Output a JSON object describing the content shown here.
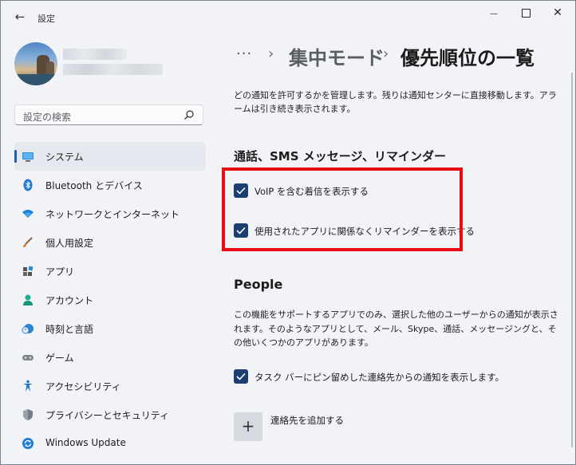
{
  "window": {
    "title": "設定",
    "back_glyph": "←",
    "minimize_glyph": "—",
    "close_glyph": "✕"
  },
  "search": {
    "placeholder": "設定の検索"
  },
  "sidebar": {
    "items": [
      {
        "label": "システム",
        "icon": "monitor-icon",
        "active": true
      },
      {
        "label": "Bluetooth とデバイス",
        "icon": "bluetooth-icon"
      },
      {
        "label": "ネットワークとインターネット",
        "icon": "wifi-icon"
      },
      {
        "label": "個人用設定",
        "icon": "brush-icon"
      },
      {
        "label": "アプリ",
        "icon": "apps-icon"
      },
      {
        "label": "アカウント",
        "icon": "person-icon"
      },
      {
        "label": "時刻と言語",
        "icon": "clock-globe-icon"
      },
      {
        "label": "ゲーム",
        "icon": "gamepad-icon"
      },
      {
        "label": "アクセシビリティ",
        "icon": "accessibility-icon"
      },
      {
        "label": "プライバシーとセキュリティ",
        "icon": "shield-icon"
      },
      {
        "label": "Windows Update",
        "icon": "update-icon"
      }
    ]
  },
  "breadcrumb": {
    "dots": "···",
    "separator": "›",
    "parent": "集中モード",
    "current": "優先順位の一覧"
  },
  "main": {
    "description": "どの通知を許可するかを管理します。残りは通知センターに直接移動します。アラームは引き続き表示されます。",
    "calls_section": {
      "title": "通話、SMS メッセージ、リマインダー",
      "checkboxes": [
        {
          "label": "VoIP を含む着信を表示する",
          "checked": true
        },
        {
          "label": "使用されたアプリに関係なくリマインダーを表示する",
          "checked": true
        }
      ]
    },
    "people_section": {
      "title": "People",
      "description": "この機能をサポートするアプリでのみ、選択した他のユーザーからの通知が表示されます。そのようなアプリとして、メール、Skype、通話、メッセージングと、その他いくつかのアプリがあります。",
      "checkbox": {
        "label": "タスク バーにピン留めした連絡先からの通知を表示します。",
        "checked": true
      },
      "add_button_glyph": "+",
      "add_label": "連絡先を追加する"
    }
  },
  "colors": {
    "accent": "#1a5fb4",
    "checkbox": "#1c3f72",
    "highlight": "#ea0b12"
  }
}
